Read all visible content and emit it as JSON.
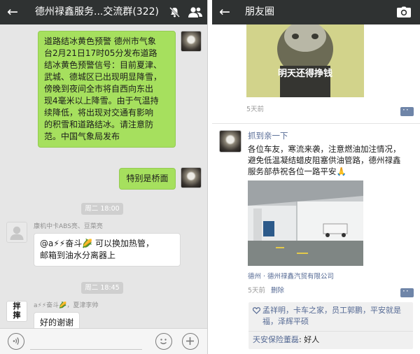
{
  "left_chat": {
    "header": {
      "title": "德州禄鑫服务...交流群(322)"
    },
    "messages": [
      {
        "text": "道路结冰黄色预警 德州市气象\n台2月21日17时05分发布道路\n结冰黄色预警信号：目前夏津、\n武城、德城区已出现明显降雪，\n傍晚到夜间全市将自西向东出\n现4毫米以上降雪。由于气温持\n续降低，将出现对交通有影响\n的积雪和道路结冰。请注意防\n范。中国气象局发布"
      },
      {
        "text": "特别是桥面"
      },
      {
        "time": "周二 18:00"
      },
      {
        "sender": "康机中卡ABS亮、豆菜亮",
        "text": "@a⚡⚡奋斗🌽 可以换加热管，\n邮箱到油水分离器上"
      },
      {
        "time": "周二 18:45"
      },
      {
        "sender": "a⚡⚡奋斗🌽，夏津李帅",
        "text": "好的谢谢",
        "avatar_text": "拌\n摔"
      }
    ]
  },
  "right_moments": {
    "header": {
      "title": "朋友圈"
    },
    "top_post": {
      "image_caption": "明天还得挣钱",
      "time": "5天前"
    },
    "post": {
      "author": "抓到亲一下",
      "text": "各位车友，寒流来袭，注意燃油加注情况，\n避免低温凝结蜡皮阻塞供油管路，德州禄鑫\n服务部恭祝各位一路平安🙏",
      "location": "德州 · 德州禄鑫汽贸有限公司",
      "time": "5天前",
      "delete_label": "删除",
      "likes": "孟祥明，卡车之家，员工郭鹏，平安就是\n福，泽辉平硕",
      "comments": [
        {
          "name": "天安保险董磊",
          "text": ": 好人"
        }
      ]
    }
  },
  "colors": {
    "topbar": "#2f3232",
    "chat_bg": "#e6e6e6",
    "bubble_green": "#a6e05e",
    "link": "#576b95",
    "meta": "#9a9a9a"
  },
  "icons": [
    "back-arrow-icon",
    "mute-icon",
    "group-members-icon",
    "camera-icon",
    "voice-icon",
    "emoji-icon",
    "plus-icon",
    "comment-icon",
    "heart-icon"
  ]
}
